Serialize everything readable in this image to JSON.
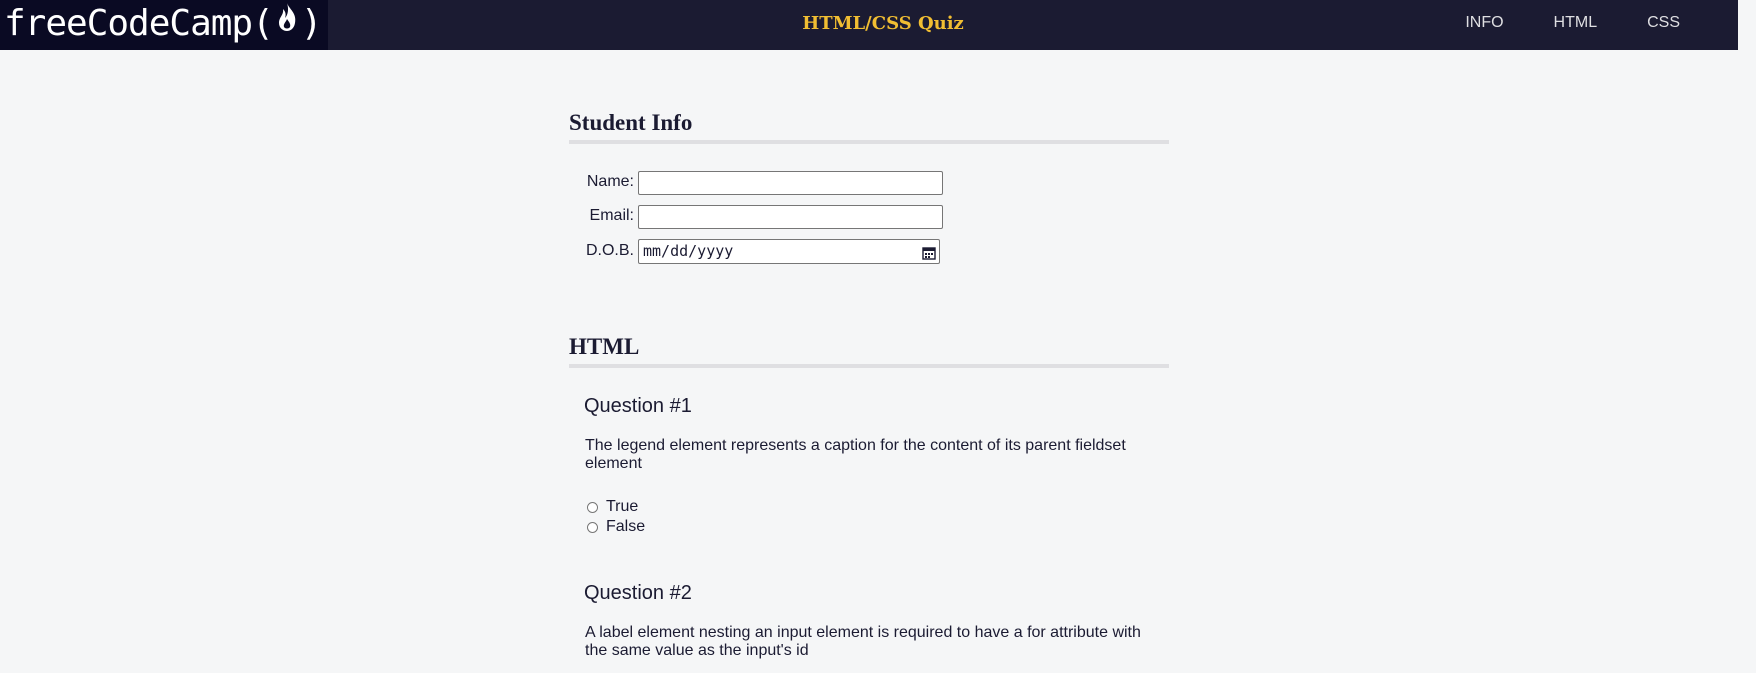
{
  "nav": {
    "logo_text": "freeCodeCamp(",
    "logo_close": ")",
    "title": "HTML/CSS Quiz",
    "links": [
      "INFO",
      "HTML",
      "CSS"
    ]
  },
  "student_info": {
    "heading": "Student Info",
    "name_label": "Name:",
    "email_label": "Email:",
    "dob_label": "D.O.B.",
    "dob_placeholder": "mm/dd/yyyy"
  },
  "html_section": {
    "heading": "HTML",
    "questions": [
      {
        "title": "Question #1",
        "text": "The legend element represents a caption for the content of its parent fieldset element",
        "options": [
          "True",
          "False"
        ]
      },
      {
        "title": "Question #2",
        "text": "A label element nesting an input element is required to have a for attribute with the same value as the input's id"
      }
    ]
  },
  "colors": {
    "nav_bg": "#1b1b32",
    "logo_bg": "#0a0a23",
    "accent": "#f1be32",
    "page_bg": "#f5f6f7"
  }
}
